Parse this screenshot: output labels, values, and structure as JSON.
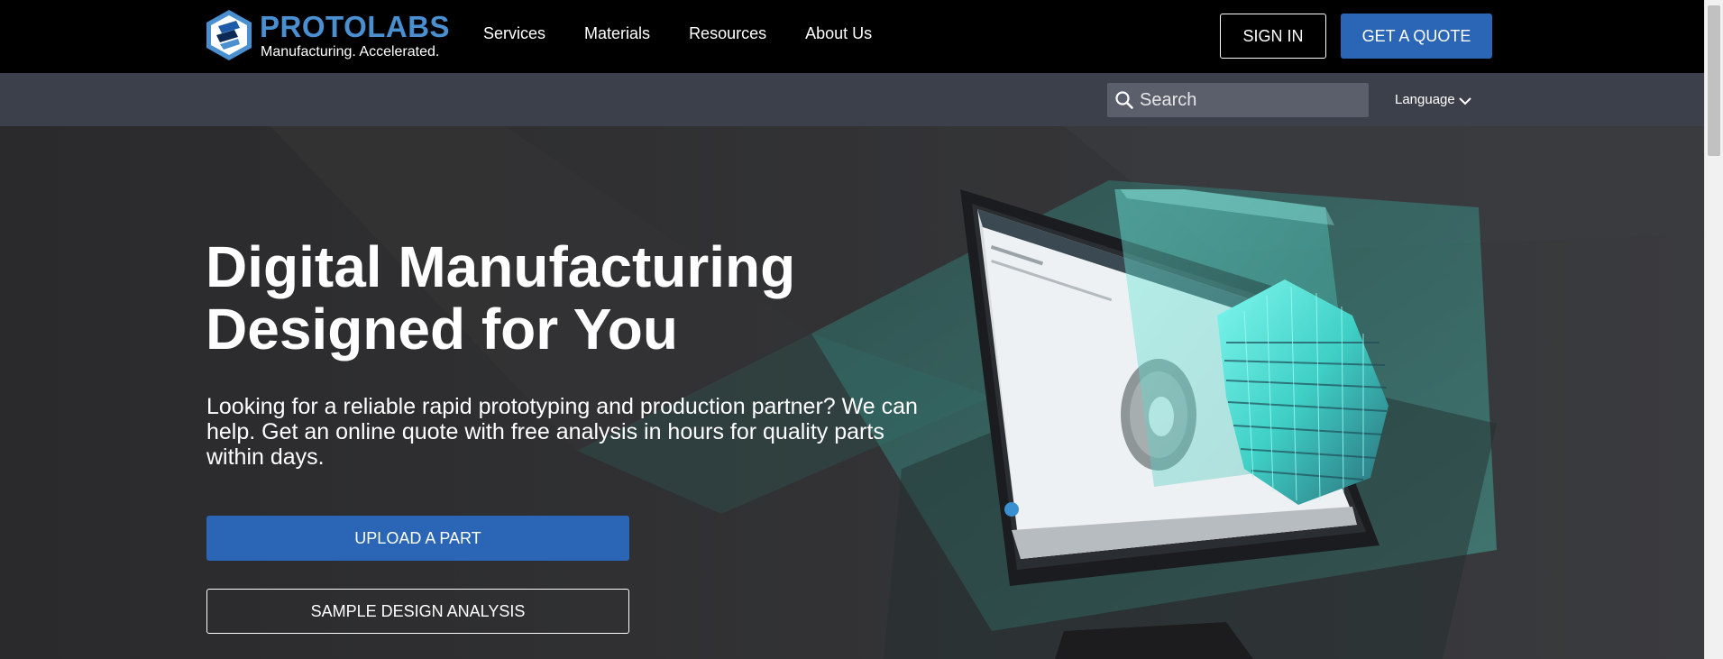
{
  "brand": {
    "name": "PROTOLABS",
    "tagline": "Manufacturing. Accelerated.",
    "color": "#4a8fd0"
  },
  "nav": {
    "items": [
      {
        "label": "Services"
      },
      {
        "label": "Materials"
      },
      {
        "label": "Resources"
      },
      {
        "label": "About Us"
      }
    ],
    "sign_in": "SIGN IN",
    "get_quote": "GET A QUOTE"
  },
  "subbar": {
    "search_placeholder": "Search",
    "language": "Language"
  },
  "hero": {
    "title_line1": "Digital Manufacturing",
    "title_line2": "Designed for You",
    "text": "Looking for a reliable rapid prototyping and production partner? We can help. Get an online quote with free analysis in hours for quality parts within days.",
    "upload_button": "UPLOAD A PART",
    "sample_button": "SAMPLE DESIGN ANALYSIS"
  },
  "colors": {
    "primary_blue": "#2b65b5",
    "nav_bg": "#000000",
    "subbar_bg": "#3c404b",
    "accent_teal": "#5fe3d8"
  }
}
